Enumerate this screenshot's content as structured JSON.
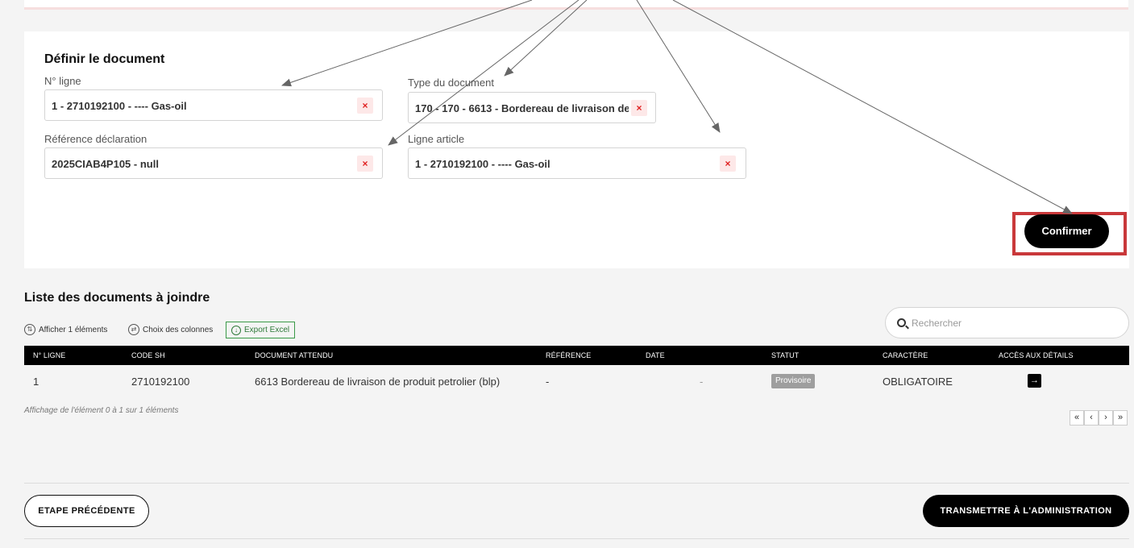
{
  "form": {
    "title": "Définir le document",
    "line_label": "N° ligne",
    "line_value": "1 - 2710192100 - ---- Gas-oil",
    "doctype_label": "Type du document",
    "doctype_value": "170 - 170 - 6613 - Bordereau de livraison de",
    "ref_label": "Référence déclaration",
    "ref_value": "2025CIAB4P105 - null",
    "article_label": "Ligne article",
    "article_value": "1 - 2710192100 - ---- Gas-oil",
    "clear_symbol": "×",
    "confirm_label": "Confirmer"
  },
  "list": {
    "title": "Liste des documents à joindre",
    "show_label": "Afficher 1 éléments",
    "columns_label": "Choix des colonnes",
    "export_label": "Export Excel",
    "search_placeholder": "Rechercher",
    "headers": [
      "N° LIGNE",
      "CODE SH",
      "DOCUMENT ATTENDU",
      "RÉFÉRENCE",
      "DATE",
      "STATUT",
      "CARACTÈRE",
      "ACCÈS AUX DÉTAILS"
    ],
    "rows": [
      {
        "line": "1",
        "code_sh": "2710192100",
        "document": "6613 Bordereau de livraison de produit petrolier (blp)",
        "reference": "-",
        "date": "-",
        "status": "Provisoire",
        "nature": "OBLIGATOIRE",
        "details_icon": "→"
      }
    ],
    "info": "Affichage de l'élément 0 à 1 sur 1 éléments",
    "pager": [
      "«",
      "‹",
      "›",
      "»"
    ]
  },
  "footer": {
    "prev_label": "ETAPE PRÉCÉDENTE",
    "send_label": "TRANSMETTRE À L'ADMINISTRATION"
  },
  "colors": {
    "accent": "#000000",
    "highlight_frame": "#c9383a",
    "clear_icon": "#e02020",
    "export_green": "#2f7a3a",
    "badge_gray": "#9e9e9e"
  }
}
